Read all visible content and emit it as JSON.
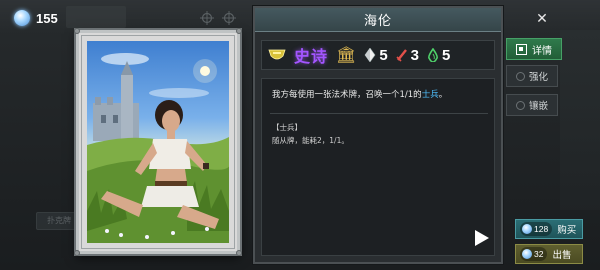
{
  "header": {
    "currency_value": "155",
    "ghost_tab_label": "",
    "currency_icon": "gem-icon",
    "close_glyph": "✕"
  },
  "card": {
    "name": "海伦",
    "rarity": "史诗",
    "rarity_color": "#a355ff",
    "stats": {
      "mana": "5",
      "attack": "3",
      "health": "5"
    },
    "description_prefix": "我方每使用一张法术牌，召唤一个1/1的",
    "description_highlight": "士兵",
    "description_suffix": "。",
    "token_name": "【士兵】",
    "token_description": "随从牌，能耗2，1/1。"
  },
  "side_buttons": {
    "detail": "详情",
    "enhance": "强化",
    "inlay": "镶嵌"
  },
  "shop": {
    "buy_price": "128",
    "buy_label": "购买",
    "sell_price": "32",
    "sell_label": "出售"
  },
  "ghost": {
    "bottom_left_label": "扑克牌"
  },
  "colors": {
    "highlight": "#4fc1ff",
    "detail_button": "#2f7a4c",
    "buy_button": "#2b6e75",
    "sell_button": "#5f5f2f"
  }
}
